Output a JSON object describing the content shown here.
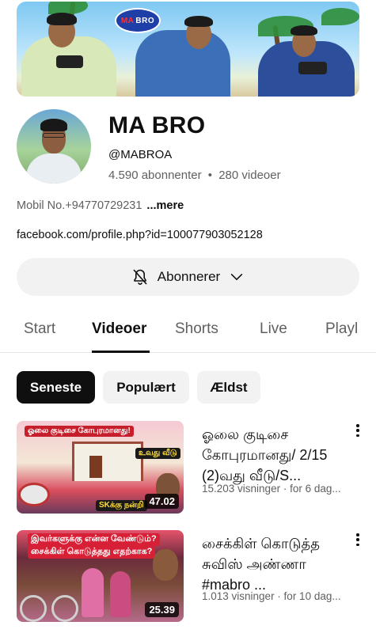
{
  "banner": {
    "logo_text": "MA BRO",
    "logo_prefix": "MA",
    "logo_suffix": "BRO"
  },
  "channel": {
    "name": "MA BRO",
    "handle": "@MABROA",
    "subscribers": "4.590 abonnenter",
    "separator": "•",
    "videos": "280 videoer",
    "description": "Mobil No.+94770729231",
    "more_label": "...mere",
    "link": "facebook.com/profile.php?id=100077903052128"
  },
  "subscribe": {
    "label": "Abonnerer",
    "bell_icon": "bell-off-icon",
    "chevron_icon": "chevron-down-icon"
  },
  "tabs": [
    {
      "label": "Start"
    },
    {
      "label": "Videoer",
      "active": true
    },
    {
      "label": "Shorts"
    },
    {
      "label": "Live"
    },
    {
      "label": "Playl"
    }
  ],
  "chips": [
    {
      "label": "Seneste",
      "selected": true
    },
    {
      "label": "Populært"
    },
    {
      "label": "Ældst"
    }
  ],
  "videos": [
    {
      "title": "ஓலை குடிசை கோபுரமானது/ 2/15 (2)வது வீடு/S...",
      "meta": "15.203 visninger · for 6 dag...",
      "duration": "47.02",
      "thumb_text_1": "ஓலை குடிசை கோபுரமானது!",
      "thumb_text_2": "உவது வீடு",
      "thumb_text_3": "SKக்கு நன்றி"
    },
    {
      "title": "சைக்கிள் கொடுத்த சுவிஸ் அண்ணா #mabro ...",
      "meta": "1.013 visninger · for 10 dag...",
      "duration": "25.39",
      "thumb_text_1": "இவர்களுக்கு என்ன வேண்டும்?",
      "thumb_text_2": "சைக்கிள் கொடுத்தது எதற்காக?"
    }
  ],
  "colors": {
    "primary_text": "#0f0f0f",
    "secondary_text": "#606060",
    "chip_bg": "#f2f2f2",
    "chip_selected_bg": "#0f0f0f"
  }
}
